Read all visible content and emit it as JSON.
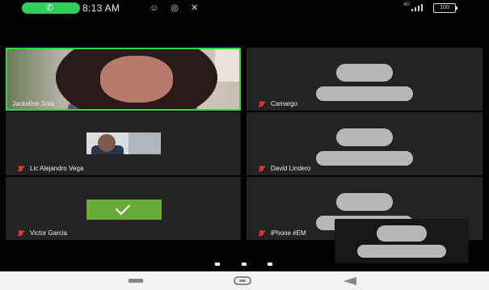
{
  "status_bar": {
    "time": "8:13 AM",
    "call_icon": "phone-icon",
    "notification_icons": "☺ ◎ ✕",
    "network_label": "4G",
    "battery_label": "100"
  },
  "participants": [
    {
      "name": "Jackeline Soto",
      "muted": true,
      "view": "video",
      "active_speaker": true
    },
    {
      "name": "Camargo",
      "muted": true,
      "view": "avatar"
    },
    {
      "name": "Lic Alejandro Vega",
      "muted": true,
      "view": "photo"
    },
    {
      "name": "David Lindero",
      "muted": true,
      "view": "avatar"
    },
    {
      "name": "Victor Garcia",
      "muted": true,
      "view": "checkmark"
    },
    {
      "name": "iPhone #EM",
      "muted": true,
      "view": "avatar"
    }
  ],
  "pagination": {
    "pages": 3,
    "current": 3
  },
  "colors": {
    "active_border": "#3bd43b",
    "tile_bg": "#232323",
    "mute_icon": "#d33333",
    "checkmark_bg": "#6aab3a"
  },
  "navbar": {
    "back_icon": "back-icon",
    "home_icon": "home-icon",
    "recent_icon": "recents-icon"
  }
}
